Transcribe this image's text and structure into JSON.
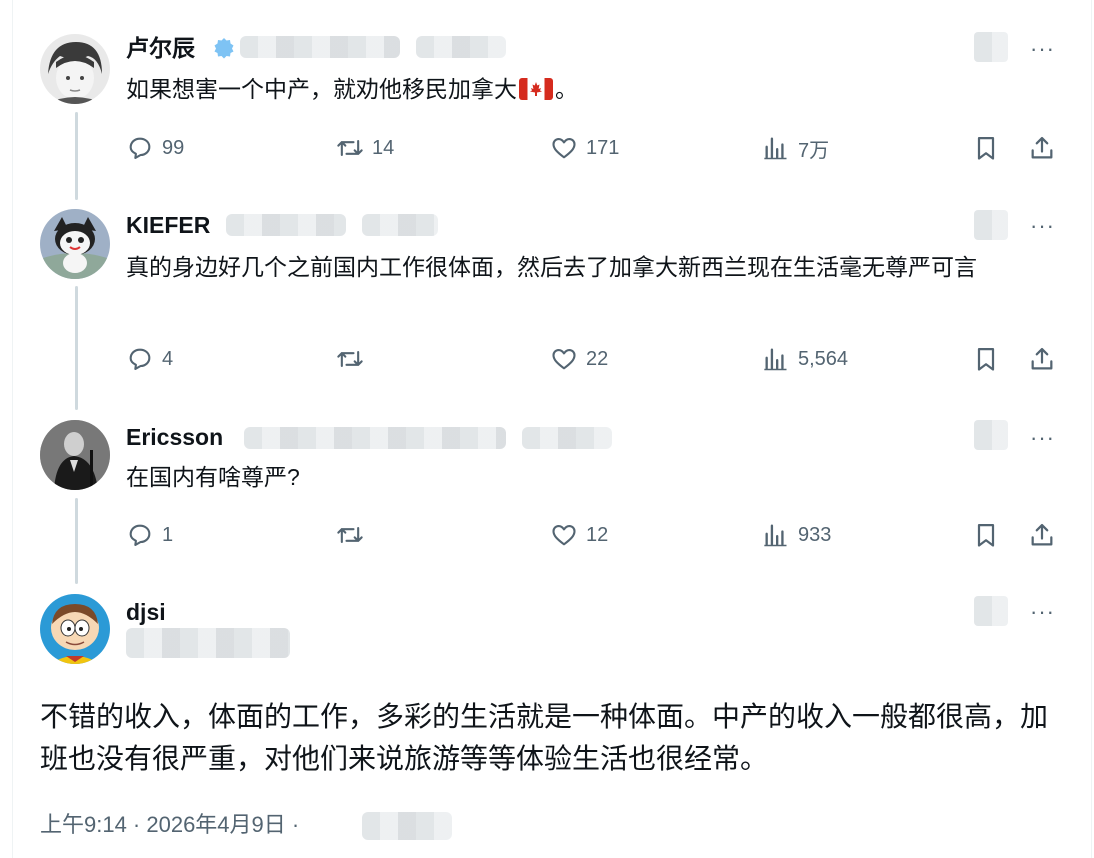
{
  "replies": [
    {
      "name": "卢尔辰",
      "text_before_flag": "如果想害一个中产，就劝他移民加拿大",
      "text_after_flag": "。",
      "flag_icon": "canada-flag-icon",
      "replies_count": "99",
      "retweets_count": "14",
      "likes_count": "171",
      "views_count": "7万"
    },
    {
      "name": "KIEFER",
      "text": "真的身边好几个之前国内工作很体面，然后去了加拿大新西兰现在生活毫无尊严可言",
      "replies_count": "4",
      "retweets_count": "",
      "likes_count": "22",
      "views_count": "5,564"
    },
    {
      "name": "Ericsson",
      "text": "在国内有啥尊严?",
      "replies_count": "1",
      "retweets_count": "",
      "likes_count": "12",
      "views_count": "933"
    }
  ],
  "main_post": {
    "name": "djsi",
    "text": "不错的收入，体面的工作，多彩的生活就是一种体面。中产的收入一般都很高，加班也没有很严重，对他们来说旅游等等体验生活也很经常。",
    "timestamp": "上午9:14 · 2026年4月9日 ·"
  },
  "more_label": "···",
  "colors": {
    "text": "#0f1419",
    "secondary": "#536471",
    "thread_line": "#cfd9de",
    "verified": "#1d9bf0"
  },
  "icons": [
    "reply-icon",
    "retweet-icon",
    "like-icon",
    "views-icon",
    "bookmark-icon",
    "share-icon",
    "more-icon"
  ]
}
